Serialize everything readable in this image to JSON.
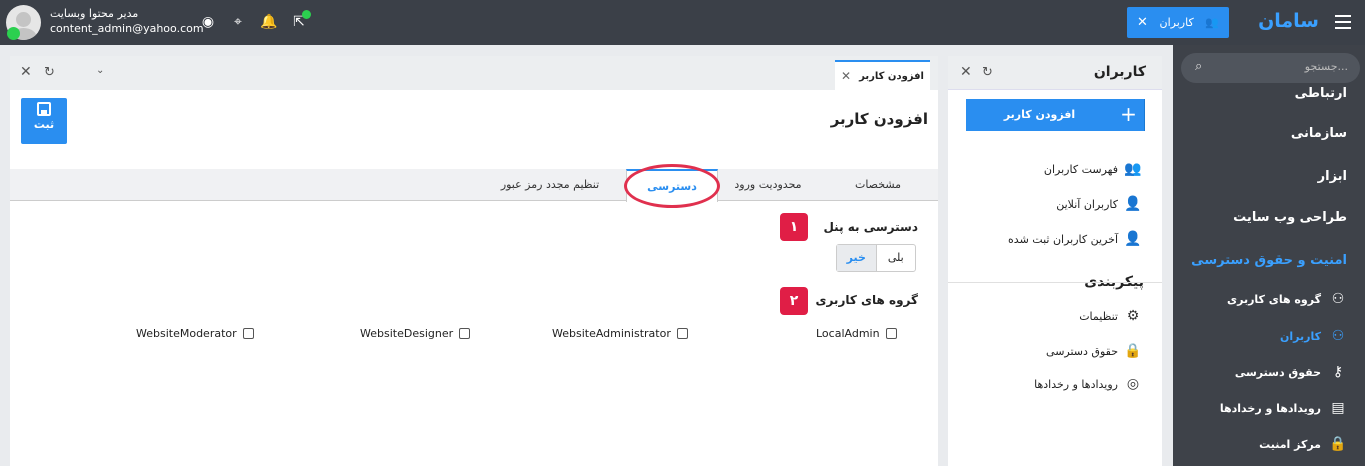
{
  "topbar": {
    "brand": "سامان",
    "open_tab": "کاربران",
    "user_name": "مدیر محتوا وبسایت",
    "user_email": "content_admin@yahoo.com"
  },
  "sidebar": {
    "search_placeholder": "جستجو...",
    "sections": [
      "ارتباطی",
      "سازمانی",
      "ابزار",
      "طراحی وب سایت",
      "امنیت و حقوق دسترسی"
    ],
    "items": [
      {
        "label": "گروه های کاربری",
        "icon": "users-group-icon"
      },
      {
        "label": "کاربران",
        "icon": "users-icon"
      },
      {
        "label": "حقوق دسترسی",
        "icon": "key-icon"
      },
      {
        "label": "رویدادها و رخدادها",
        "icon": "log-icon"
      },
      {
        "label": "مرکز امنیت",
        "icon": "lock-icon"
      }
    ]
  },
  "users_panel": {
    "title": "کاربران",
    "add_button": "افزودن کاربر",
    "links": [
      "فهرست کاربران",
      "کاربران آنلاین",
      "آخرین کاربران ثبت شده"
    ],
    "config_header": "پیکربندی",
    "config_links": [
      "تنظیمات",
      "حقوق دسترسی",
      "رویدادها و رخدادها"
    ]
  },
  "main": {
    "tab_label": "افزودن کاربر",
    "page_title": "افزودن کاربر",
    "save_label": "ثبت",
    "tabs": [
      "مشخصات",
      "محدودیت ورود",
      "دسترسی",
      "تنظیم مجدد رمز عبور"
    ],
    "panel_access_label": "دسترسی به پنل",
    "badge1": "۱",
    "yes": "بلی",
    "no": "خیر",
    "groups_label": "گروه های کاربری",
    "badge2": "۲",
    "groups": [
      "LocalAdmin",
      "WebsiteAdministrator",
      "WebsiteDesigner",
      "WebsiteModerator"
    ]
  },
  "colors": {
    "accent": "#2a8ef0",
    "topbar": "#3b4048",
    "highlight": "#e01e46"
  }
}
